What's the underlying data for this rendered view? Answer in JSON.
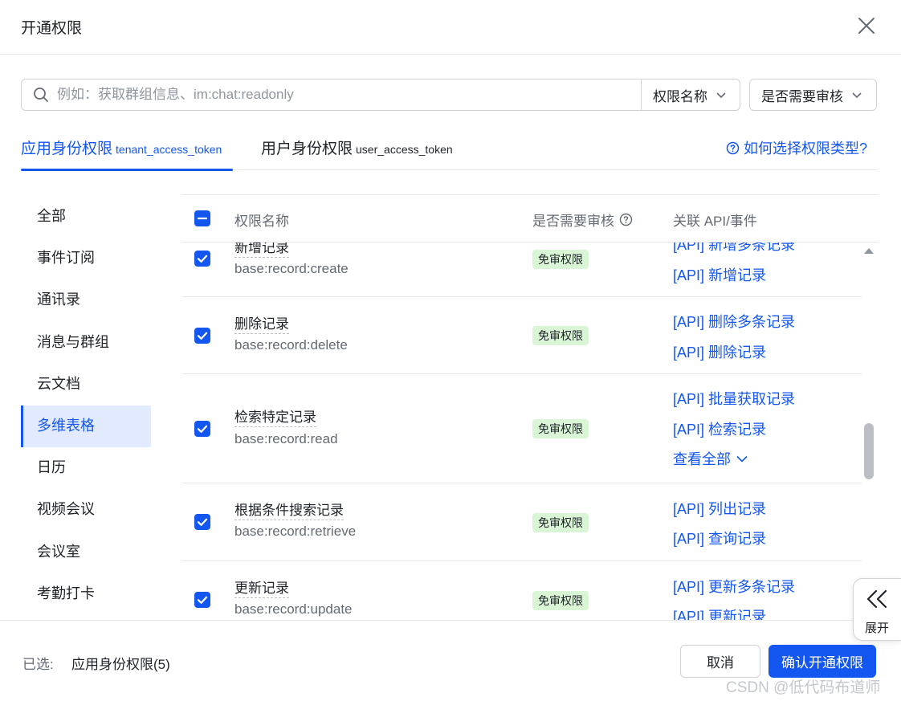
{
  "dialog": {
    "title": "开通权限"
  },
  "search": {
    "placeholder": "例如：获取群组信息、im:chat:readonly",
    "value": ""
  },
  "filters": {
    "permission_name": "权限名称",
    "needs_review": "是否需要审核"
  },
  "tabs": [
    {
      "label": "应用身份权限",
      "sub": "tenant_access_token",
      "active": true
    },
    {
      "label": "用户身份权限",
      "sub": "user_access_token",
      "active": false
    }
  ],
  "help_link": "如何选择权限类型?",
  "sidebar": {
    "items": [
      {
        "label": "全部"
      },
      {
        "label": "事件订阅"
      },
      {
        "label": "通讯录"
      },
      {
        "label": "消息与群组"
      },
      {
        "label": "云文档"
      },
      {
        "label": "多维表格",
        "active": true
      },
      {
        "label": "日历"
      },
      {
        "label": "视频会议"
      },
      {
        "label": "会议室"
      },
      {
        "label": "考勤打卡"
      }
    ]
  },
  "table": {
    "headers": {
      "name": "权限名称",
      "audit": "是否需要审核",
      "api": "关联 API/事件"
    },
    "rows": [
      {
        "name": "新增记录",
        "code": "base:record:create",
        "badge": "免审权限",
        "apis": [
          "[API] 新增多条记录",
          "[API] 新增记录"
        ]
      },
      {
        "name": "删除记录",
        "code": "base:record:delete",
        "badge": "免审权限",
        "apis": [
          "[API] 删除多条记录",
          "[API] 删除记录"
        ]
      },
      {
        "name": "检索特定记录",
        "code": "base:record:read",
        "badge": "免审权限",
        "apis": [
          "[API] 批量获取记录",
          "[API] 检索记录"
        ],
        "more": "查看全部"
      },
      {
        "name": "根据条件搜索记录",
        "code": "base:record:retrieve",
        "badge": "免审权限",
        "apis": [
          "[API] 列出记录",
          "[API] 查询记录"
        ]
      },
      {
        "name": "更新记录",
        "code": "base:record:update",
        "badge": "免审权限",
        "apis": [
          "[API] 更新多条记录",
          "[API] 更新记录"
        ]
      }
    ]
  },
  "expand": {
    "label": "展开"
  },
  "footer": {
    "selected_label": "已选:",
    "selected_value": "应用身份权限(5)",
    "cancel": "取消",
    "confirm": "确认开通权限"
  },
  "watermark": "CSDN @低代码布道师",
  "colors": {
    "accent": "#1456f0",
    "badge_bg": "#d9f5d6",
    "active_bg": "#e1eaff"
  }
}
